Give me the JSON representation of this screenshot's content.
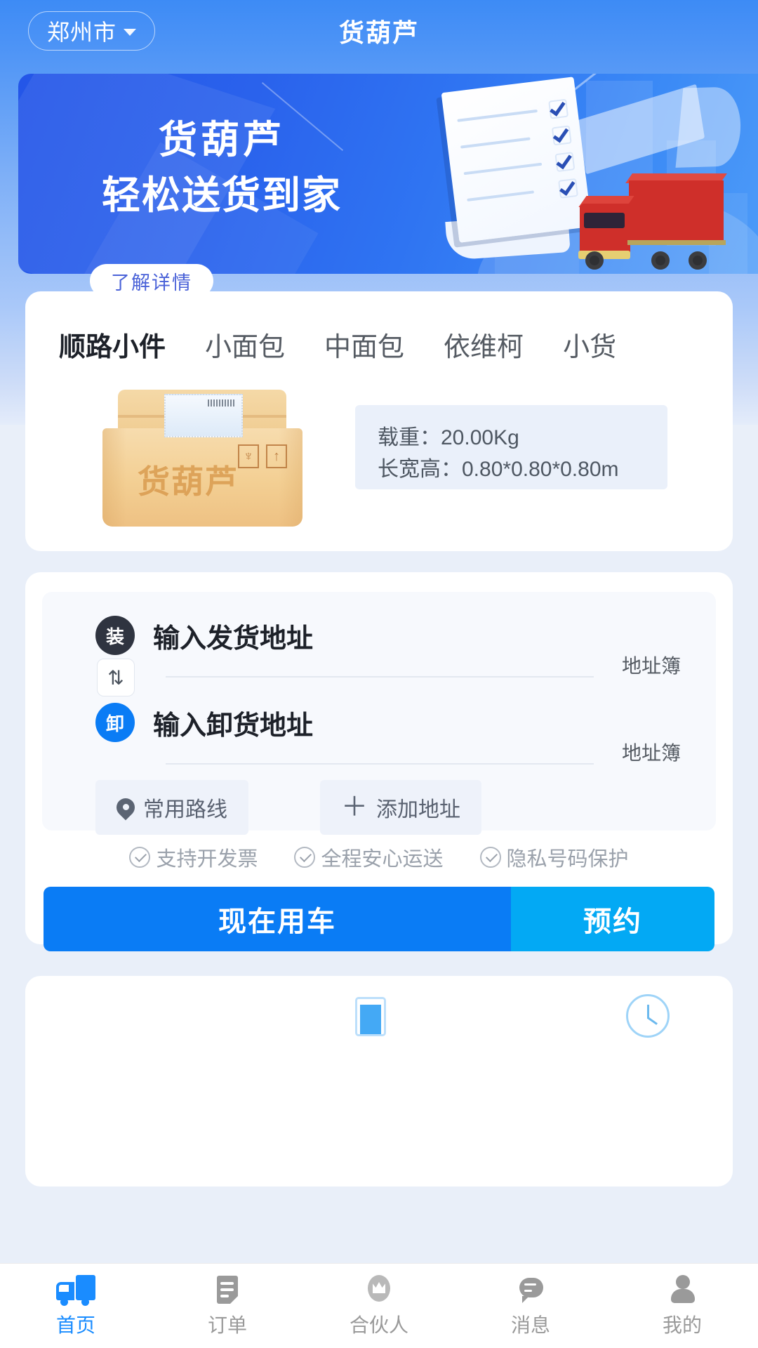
{
  "header": {
    "city": "郑州市",
    "city_caret": "chevron-down-icon",
    "title": "货葫芦"
  },
  "banner": {
    "line1": "货葫芦",
    "line2": "轻松送货到家",
    "cta_label": "了解详情"
  },
  "vehicle": {
    "tabs": [
      {
        "label": "顺路小件",
        "active": true
      },
      {
        "label": "小面包",
        "active": false
      },
      {
        "label": "中面包",
        "active": false
      },
      {
        "label": "依维柯",
        "active": false
      },
      {
        "label": "小货",
        "active": false
      }
    ],
    "package_brand": "货葫芦",
    "spec_weight": "载重：20.00Kg",
    "spec_size": "长宽高：0.80*0.80*0.80m"
  },
  "order": {
    "pickup_badge": "装",
    "pickup_placeholder": "输入发货地址",
    "pickup_addressbook": "地址簿",
    "swap_icon": "swap-icon",
    "dropoff_badge": "卸",
    "dropoff_placeholder": "输入卸货地址",
    "dropoff_addressbook": "地址簿",
    "chip_route": "常用路线",
    "chip_add": "添加地址",
    "features": [
      "支持开发票",
      "全程安心运送",
      "隐私号码保护"
    ],
    "cta_now": "现在用车",
    "cta_book": "预约"
  },
  "bottom_nav": [
    {
      "label": "首页",
      "icon": "truck-icon",
      "active": true
    },
    {
      "label": "订单",
      "icon": "document-icon",
      "active": false
    },
    {
      "label": "合伙人",
      "icon": "crown-icon",
      "active": false
    },
    {
      "label": "消息",
      "icon": "chat-icon",
      "active": false
    },
    {
      "label": "我的",
      "icon": "person-icon",
      "active": false
    }
  ],
  "colors": {
    "primary": "#0a7cf5",
    "accent": "#03a9f4",
    "tab_underline": "#2f9bf2",
    "background": "#e9eff9",
    "badge_load": "#2f3440",
    "badge_unload": "#0a7cf5"
  }
}
